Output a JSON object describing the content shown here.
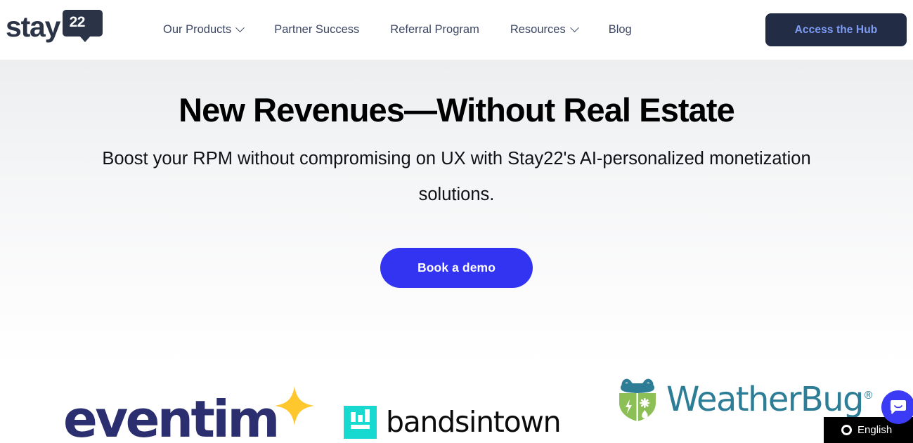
{
  "header": {
    "logo": {
      "word": "stay",
      "badge": "22",
      "icon": "stay22-logo"
    },
    "nav": [
      {
        "label": "Our Products",
        "has_dropdown": true
      },
      {
        "label": "Partner Success",
        "has_dropdown": false
      },
      {
        "label": "Referral Program",
        "has_dropdown": false
      },
      {
        "label": "Resources",
        "has_dropdown": true
      },
      {
        "label": "Blog",
        "has_dropdown": false
      }
    ],
    "cta": {
      "label": "Access the Hub",
      "bg": "#232c45",
      "color": "#7e9bf5"
    }
  },
  "hero": {
    "headline": "New Revenues—Without Real Estate",
    "subheadline": "Boost your RPM without compromising on UX with Stay22's AI-personalized monetization solutions.",
    "cta": {
      "label": "Book a demo",
      "bg": "#3333f2",
      "color": "#ffffff"
    }
  },
  "partners": [
    {
      "name": "eventim",
      "text": "eventim",
      "color": "#2c2f6f",
      "accent": "#fec72e"
    },
    {
      "name": "bandsintown",
      "text": "bandsintown",
      "color": "#0b0b0b",
      "accent": "#18d9d0"
    },
    {
      "name": "weatherbug",
      "text": "WeatherBug",
      "trademark": "®",
      "color": "#2e7d96",
      "accent": "#8cbf55"
    }
  ],
  "widgets": {
    "language": {
      "label": "English",
      "icon": "circle-icon",
      "bg": "#000000"
    },
    "chat": {
      "icon": "chat-bubble-smile-icon",
      "bg": "#3b3bf5"
    }
  }
}
